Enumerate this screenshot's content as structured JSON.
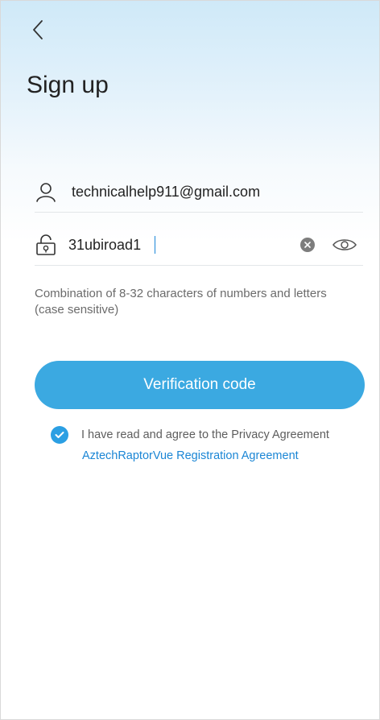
{
  "header": {
    "back_icon": "chevron-left-icon",
    "title": "Sign up"
  },
  "form": {
    "email": {
      "icon": "user-icon",
      "value": "technicalhelp911@gmail.com"
    },
    "password": {
      "icon": "lock-icon",
      "value": "31ubiroad1",
      "clear_icon": "clear-icon",
      "toggle_icon": "eye-icon"
    },
    "hint": "Combination of 8-32 characters of numbers and letters (case sensitive)"
  },
  "verify_button_label": "Verification code",
  "agreement": {
    "checked": true,
    "text": "I have read and agree to the Privacy Agreement",
    "link": "AztechRaptorVue Registration Agreement"
  },
  "colors": {
    "accent": "#3ba9e1",
    "link": "#1b86d5"
  }
}
